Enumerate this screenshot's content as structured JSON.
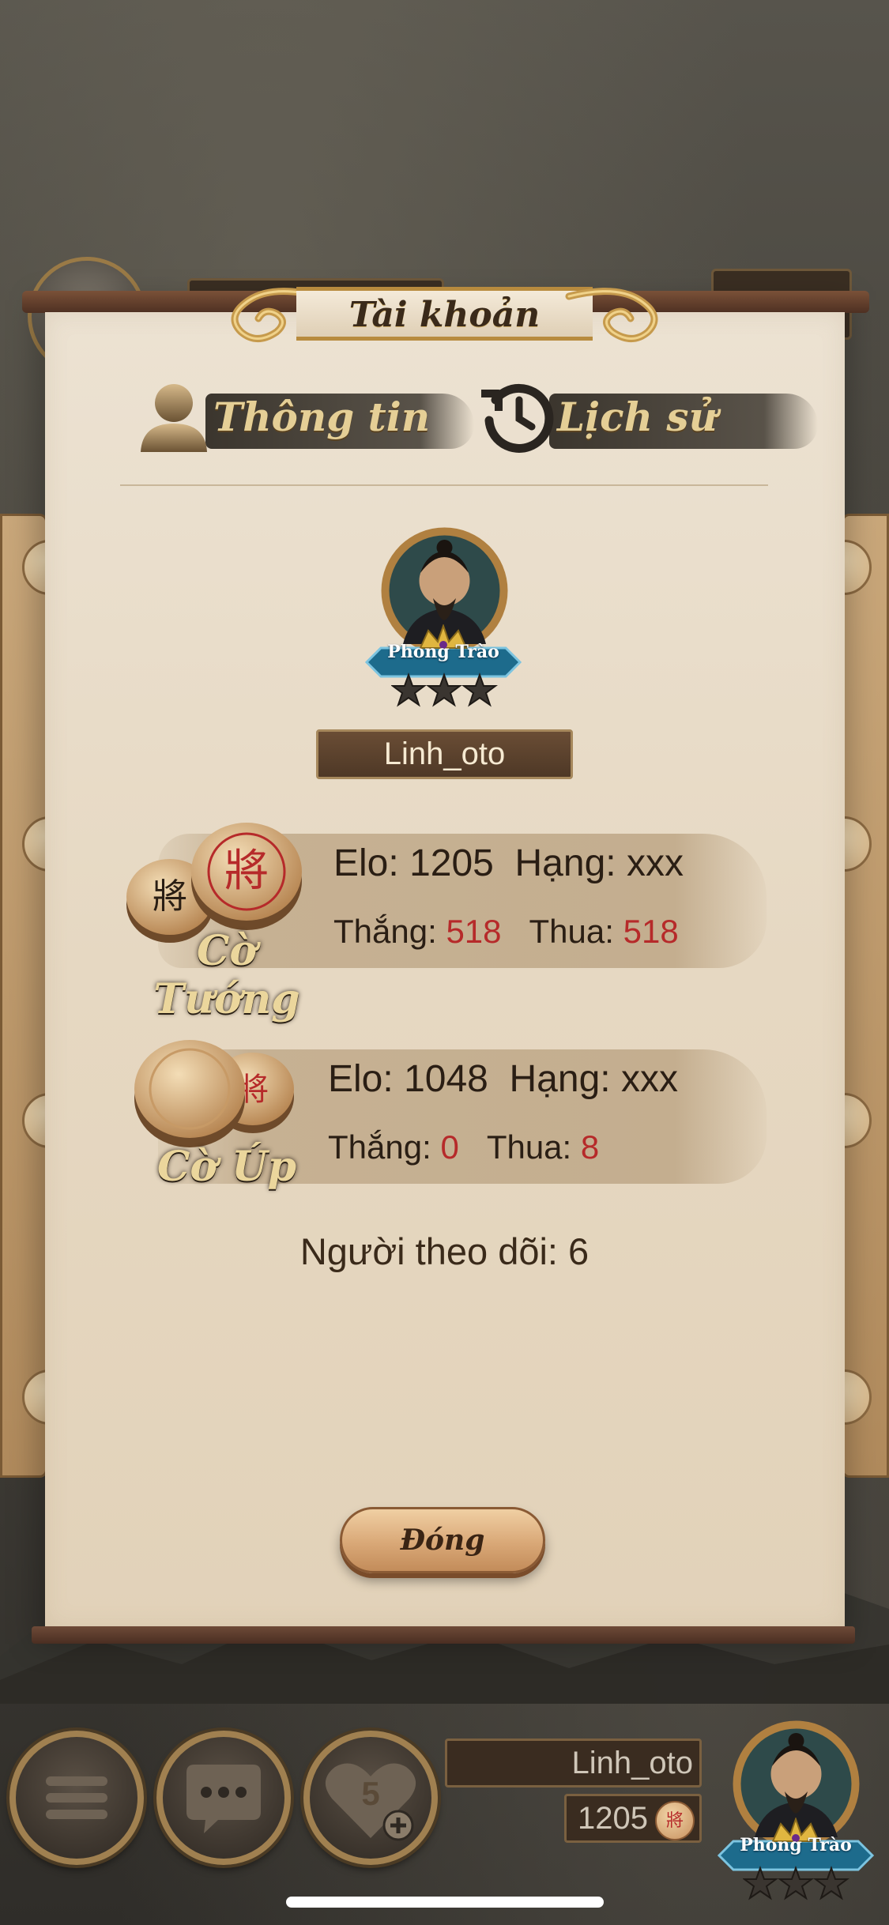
{
  "dialog": {
    "title": "Tài khoản",
    "tabs": [
      {
        "label": "Thông tin",
        "icon": "user-icon",
        "selected": true
      },
      {
        "label": "Lịch sử",
        "icon": "history-icon",
        "selected": false
      }
    ],
    "profile": {
      "rank": "Phong Trào",
      "stars": 3,
      "username": "Linh_oto"
    },
    "games": [
      {
        "name": "Cờ Tướng",
        "piece_char": "將",
        "elo_label": "Elo:",
        "elo": "1205",
        "rank_label": "Hạng:",
        "rank": "xxx",
        "wins_label": "Thắng:",
        "wins": "518",
        "losses_label": "Thua:",
        "losses": "518"
      },
      {
        "name": "Cờ Úp",
        "piece_char": "將",
        "elo_label": "Elo:",
        "elo": "1048",
        "rank_label": "Hạng:",
        "rank": "xxx",
        "wins_label": "Thắng:",
        "wins": "0",
        "losses_label": "Thua:",
        "losses": "8"
      }
    ],
    "followers_text": "Người theo dõi: 6",
    "close_label": "Đóng"
  },
  "bottom_bar": {
    "menu_icon": "hamburger-menu-icon",
    "chat_icon": "chat-bubble-icon",
    "hearts_icon": "heart-plus-icon",
    "hearts_count": "5",
    "username": "Linh_oto",
    "elo": "1205",
    "coin_char": "將",
    "rank": "Phong Trào"
  },
  "colors": {
    "accent_gold": "#e5cf96",
    "stat_red": "#b62a2a",
    "parchment": "#e6d8c2"
  }
}
